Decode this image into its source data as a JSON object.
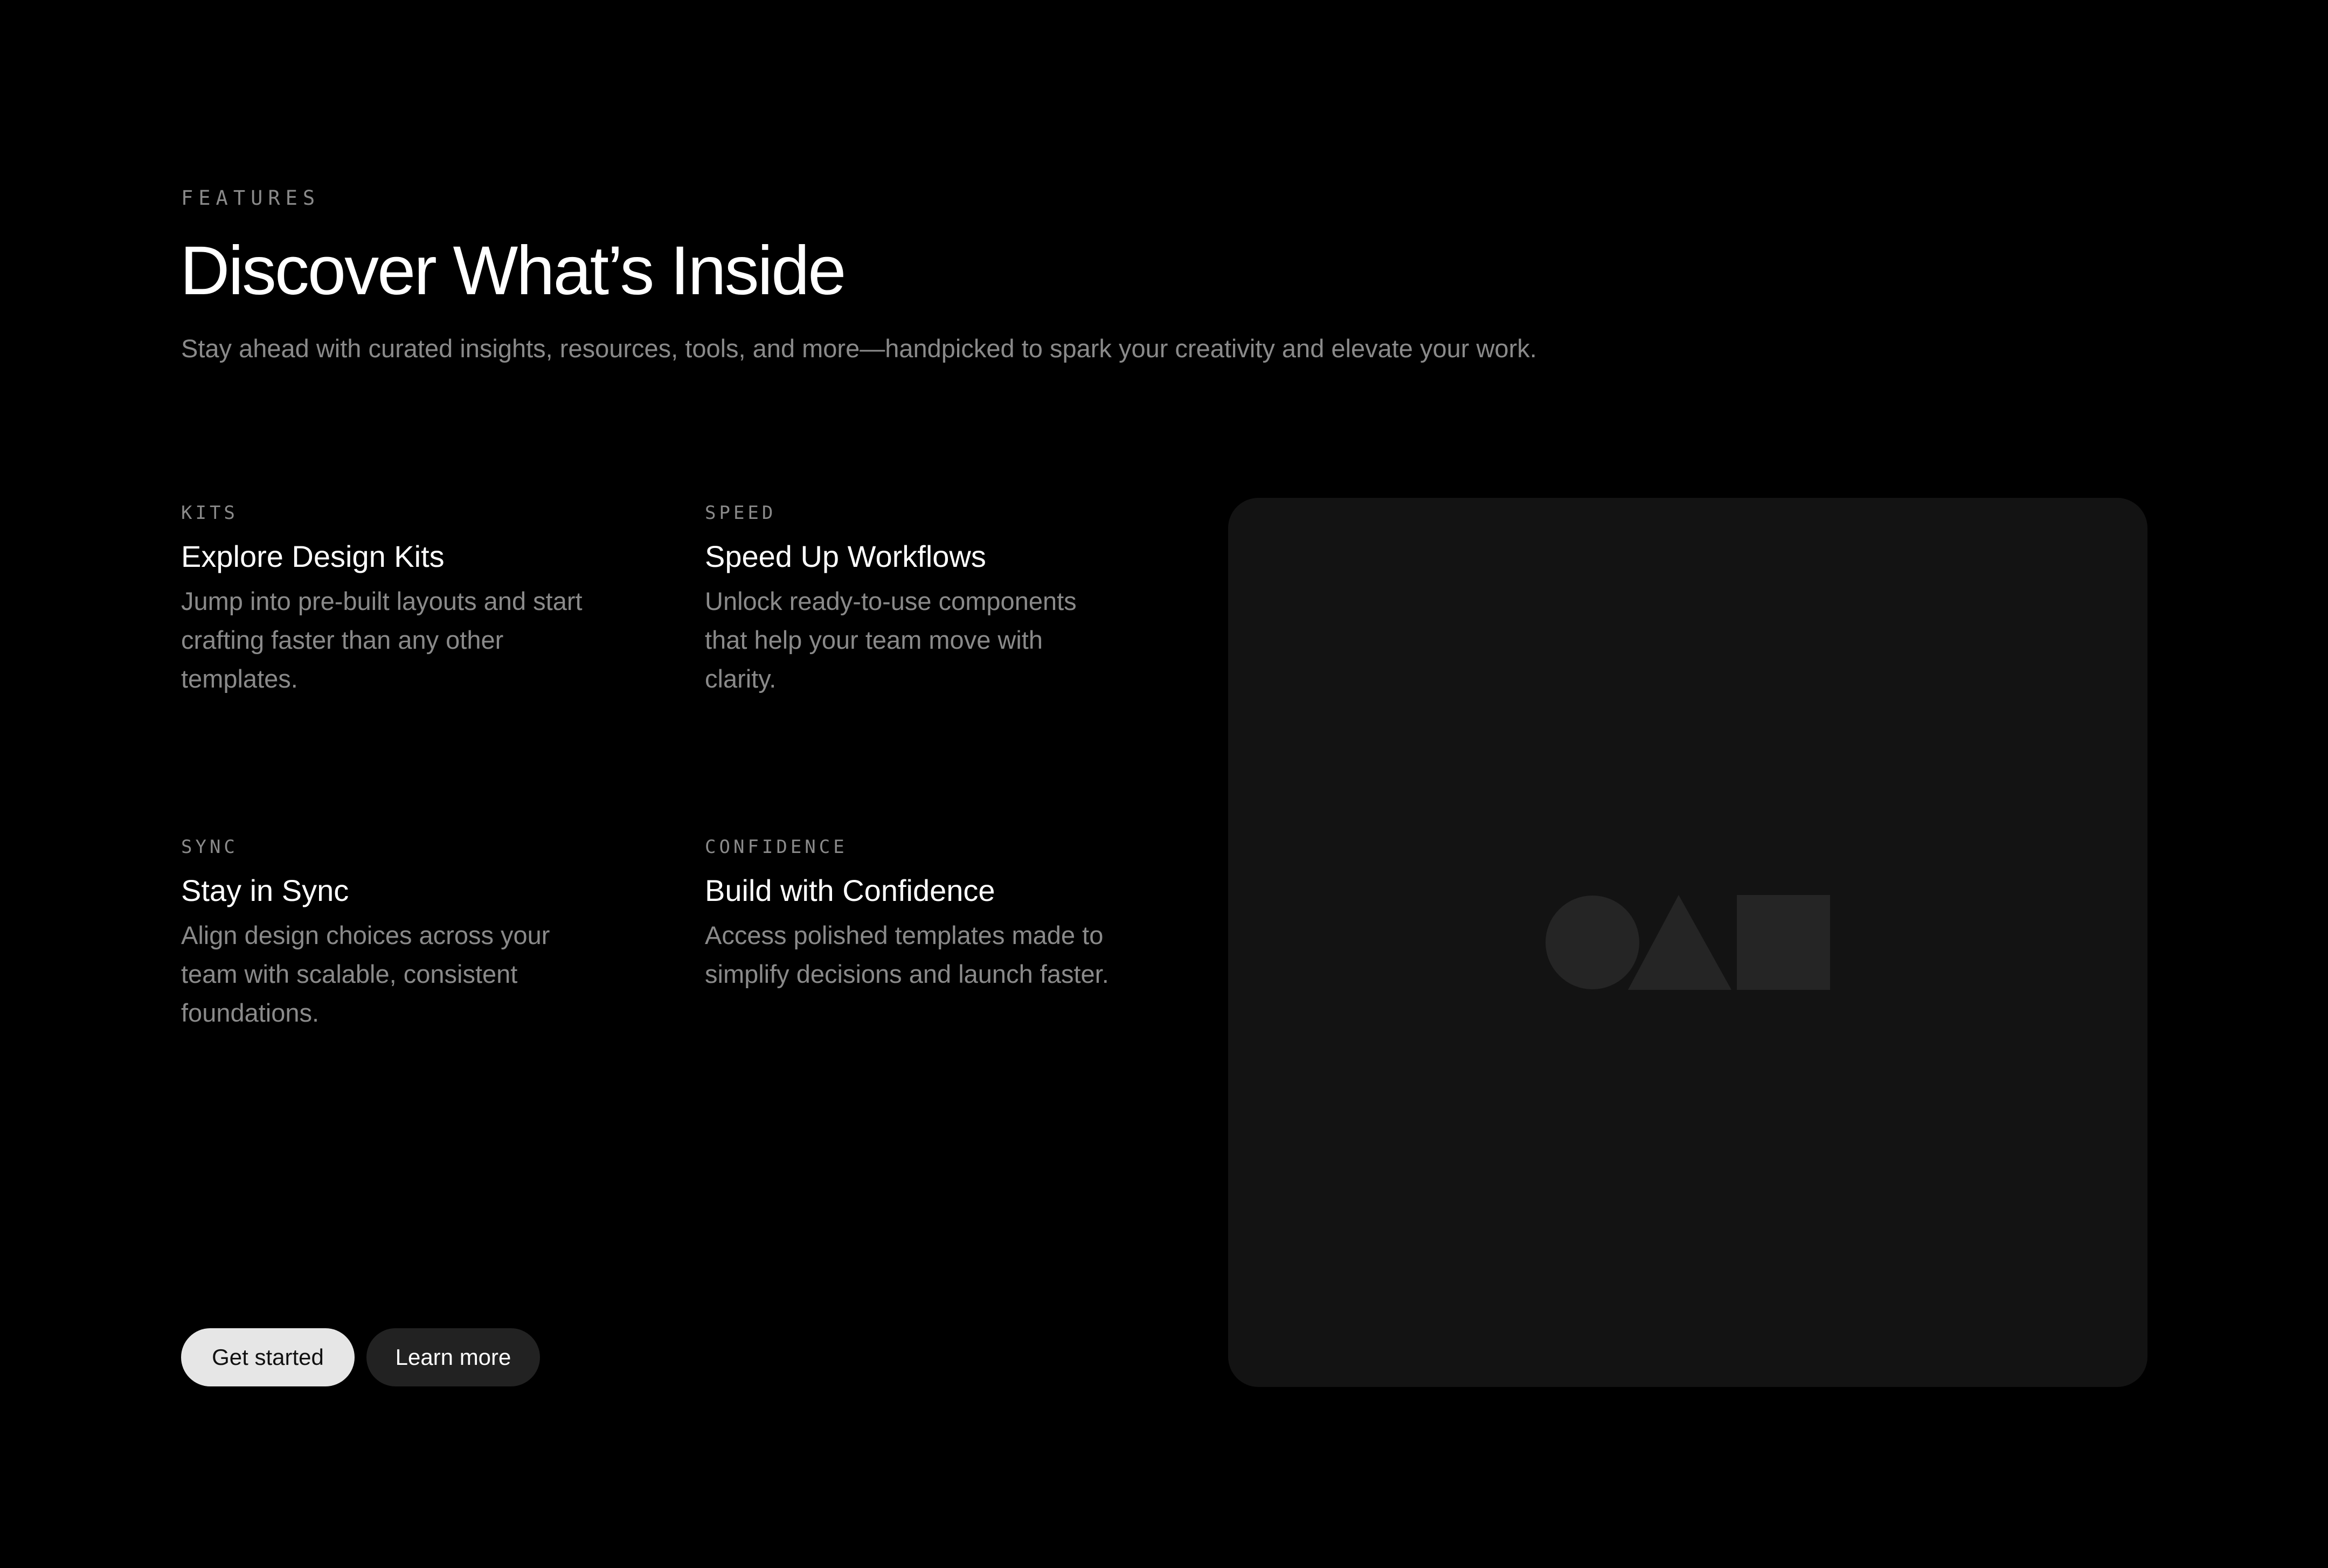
{
  "section": {
    "eyebrow": "FEATURES",
    "title": "Discover What’s Inside",
    "subtitle": "Stay ahead with curated insights, resources, tools, and more—handpicked to spark your creativity and elevate your work."
  },
  "features": [
    {
      "eyebrow": "KITS",
      "title": "Explore Design Kits",
      "description": "Jump into pre-built layouts and start crafting faster than any other templates."
    },
    {
      "eyebrow": "SPEED",
      "title": "Speed Up Workflows",
      "description": "Unlock ready-to-use components that help your team move with clarity."
    },
    {
      "eyebrow": "SYNC",
      "title": "Stay in Sync",
      "description": "Align design choices across your team with scalable, consistent foundations."
    },
    {
      "eyebrow": "CONFIDENCE",
      "title": "Build with Confidence",
      "description": "Access polished templates made to simplify decisions and launch faster."
    }
  ],
  "actions": {
    "primary_label": "Get started",
    "secondary_label": "Learn more"
  },
  "media": {
    "placeholder_icon": "shapes-placeholder-icon"
  },
  "colors": {
    "background": "#000000",
    "card": "#131313",
    "muted_text": "#8a8a8a",
    "primary_button": "#e6e6e6",
    "secondary_button": "#222222",
    "placeholder_shape": "#252525"
  }
}
